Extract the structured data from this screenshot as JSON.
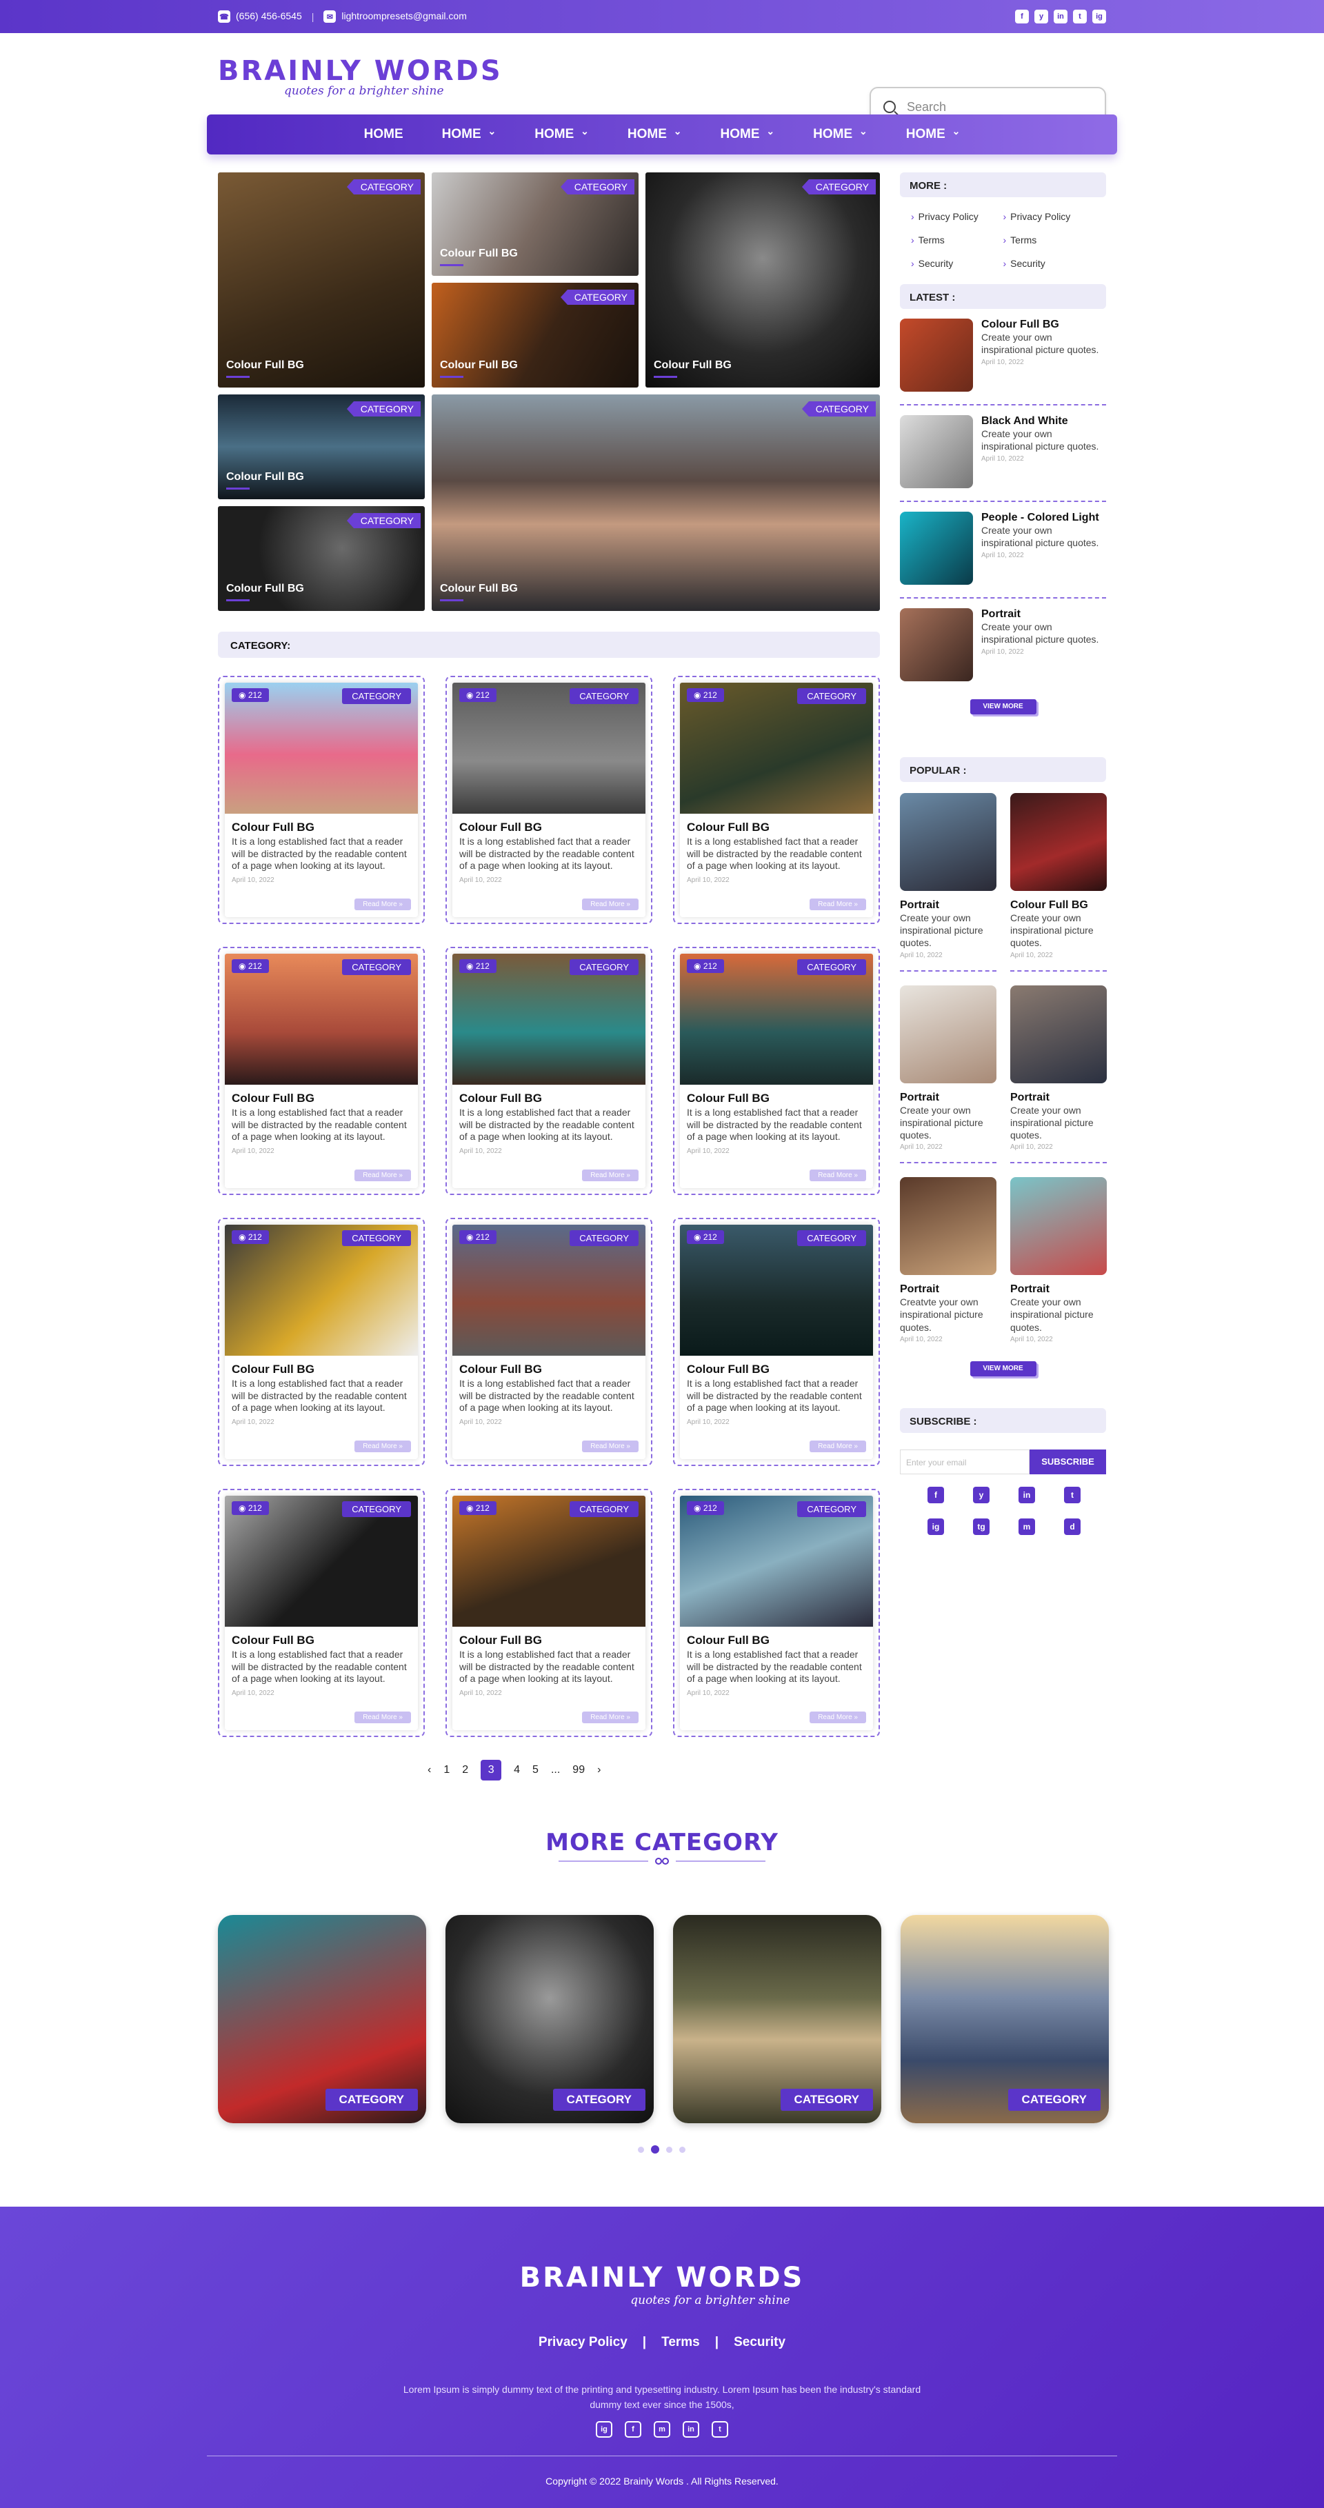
{
  "topbar": {
    "phone": "(656) 456-6545",
    "email": "lightroompresets@gmail.com",
    "social": [
      "f",
      "y",
      "in",
      "t",
      "ig"
    ]
  },
  "header": {
    "logo": "BRAINLY WORDS",
    "tagline": "quotes for a brighter shine",
    "search_placeholder": "Search"
  },
  "nav": [
    "HOME",
    "HOME",
    "HOME",
    "HOME",
    "HOME",
    "HOME",
    "HOME"
  ],
  "hero": {
    "category": "CATEGORY",
    "caption": "Colour Full BG"
  },
  "sidebar": {
    "more_title": "MORE :",
    "more_links": [
      "Privacy Policy",
      "Privacy Policy",
      "Terms",
      "Terms",
      "Security",
      "Security"
    ],
    "latest_title": "LATEST :",
    "latest": [
      {
        "title": "Colour Full BG",
        "desc": "Create your own inspirational picture quotes.",
        "date": "April 10, 2022"
      },
      {
        "title": "Black And White",
        "desc": "Create your own inspirational picture quotes.",
        "date": "April 10, 2022"
      },
      {
        "title": "People - Colored Light",
        "desc": "Create your own inspirational picture quotes.",
        "date": "April 10, 2022"
      },
      {
        "title": "Portrait",
        "desc": "Create your own inspirational picture quotes.",
        "date": "April 10, 2022"
      }
    ],
    "view_more": "VIEW MORE",
    "popular_title": "POPULAR :",
    "popular": [
      {
        "title": "Portrait",
        "desc": "Create your own inspirational picture quotes.",
        "date": "April 10, 2022"
      },
      {
        "title": "Colour Full BG",
        "desc": "Create your own inspirational picture quotes.",
        "date": "April 10, 2022"
      },
      {
        "title": "Portrait",
        "desc": "Create your own inspirational picture quotes.",
        "date": "April 10, 2022"
      },
      {
        "title": "Portrait",
        "desc": "Create your own inspirational picture quotes.",
        "date": "April 10, 2022"
      },
      {
        "title": "Portrait",
        "desc": "Creatvte your own inspirational picture quotes.",
        "date": "April 10, 2022"
      },
      {
        "title": "Portrait",
        "desc": "Create your own inspirational picture quotes.",
        "date": "April 10, 2022"
      }
    ],
    "subscribe_title": "SUBSCRIBE :",
    "email_placeholder": "Enter your email",
    "subscribe_btn": "SUBSCRIBE",
    "social": [
      "f",
      "y",
      "in",
      "t",
      "ig",
      "tg",
      "m",
      "d"
    ]
  },
  "category": {
    "heading": "CATEGORY:",
    "views": "212",
    "badge": "CATEGORY",
    "title": "Colour Full BG",
    "desc": "It is a long established fact that a reader will be distracted by the readable content of a page when looking at its layout.",
    "date": "April 10, 2022",
    "read_more": "Read More"
  },
  "pagination": {
    "prev": "‹",
    "pages": [
      "1",
      "2",
      "3",
      "4",
      "5",
      "...",
      "99"
    ],
    "next": "›",
    "active": "3"
  },
  "more_category": {
    "heading": "MORE CATEGORY",
    "label": "CATEGORY"
  },
  "footer": {
    "logo": "BRAINLY WORDS",
    "tagline": "quotes for a brighter shine",
    "links": [
      "Privacy Policy",
      "|",
      "Terms",
      "|",
      "Security"
    ],
    "text": "Lorem Ipsum is simply dummy text of the printing and typesetting industry. Lorem Ipsum has been the industry's standard dummy text ever since the 1500s,",
    "social": [
      "ig",
      "f",
      "m",
      "in",
      "t"
    ],
    "copyright": "Copyright © 2022 Brainly Words . All Rights Reserved."
  },
  "colors": {
    "brand": "#5b35c9",
    "accent": "#8a6be0"
  }
}
